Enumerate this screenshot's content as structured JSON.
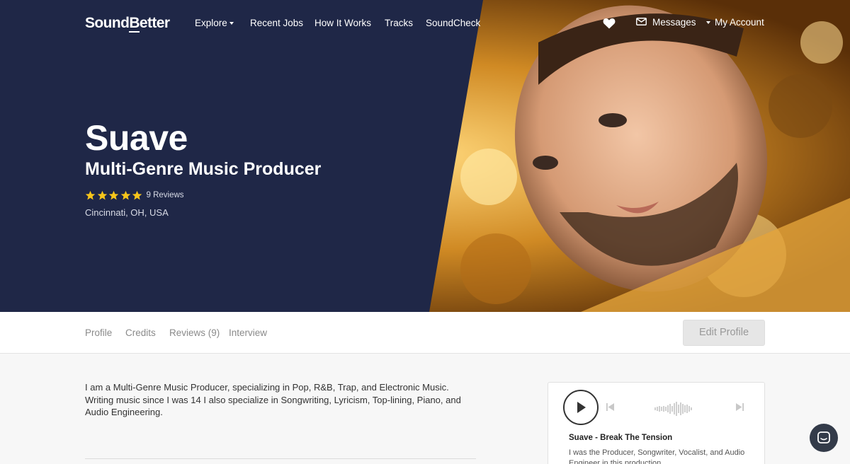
{
  "nav": {
    "logo_prefix": "Sound",
    "logo_underlined": "B",
    "logo_suffix": "etter",
    "explore": "Explore",
    "recent_jobs": "Recent Jobs",
    "how_it_works": "How It Works",
    "tracks": "Tracks",
    "soundcheck": "SoundCheck",
    "messages": "Messages",
    "my_account": "My Account"
  },
  "profile": {
    "name": "Suave",
    "title": "Multi-Genre Music Producer",
    "rating": 5,
    "reviews_label": "9 Reviews",
    "location": "Cincinnati, OH, USA"
  },
  "tabs": [
    {
      "label": "Profile"
    },
    {
      "label": "Credits"
    },
    {
      "label": "Reviews (9)"
    },
    {
      "label": "Interview"
    }
  ],
  "edit_profile_label": "Edit Profile",
  "bio": {
    "line1": "I am a Multi-Genre Music Producer, specializing in Pop, R&B, Trap, and Electronic Music.",
    "line2": "Writing music since I was 14 I also specialize in Songwriting, Lyricism, Top-lining, Piano, and",
    "line3": "Audio Engineering."
  },
  "player": {
    "track_title": "Suave - Break The Tension",
    "track_desc": "I was the Producer, Songwriter, Vocalist, and Audio Engineer in this production."
  },
  "colors": {
    "navy": "#1f2747",
    "star": "#f7c51b",
    "photo_gold": "#c98a2a"
  },
  "icons": {
    "favorite": "heart-icon",
    "messages": "mail-icon",
    "account": "caret-down-icon",
    "play": "play-icon",
    "prev": "skip-back-icon",
    "next": "skip-forward-icon",
    "chat": "chat-icon"
  }
}
